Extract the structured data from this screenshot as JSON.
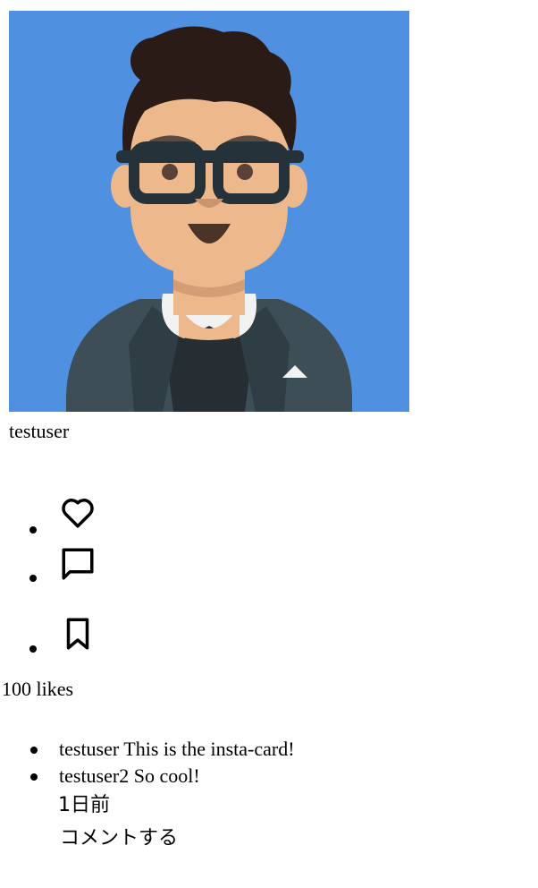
{
  "post": {
    "username": "testuser",
    "likes": "100 likes",
    "time": "1日前",
    "comment_action": "コメントする"
  },
  "actions": [
    {
      "icon": "heart-icon"
    },
    {
      "icon": "comment-icon"
    },
    {
      "icon": "bookmark-icon"
    }
  ],
  "comments": [
    {
      "text": "testuser This is the insta-card!"
    },
    {
      "text": "testuser2 So cool!"
    }
  ],
  "colors": {
    "avatar_bg": "#4f91e0",
    "hair": "#2a1b17",
    "skin": "#edb88b",
    "glasses": "#253239",
    "jacket": "#3e4e57",
    "shirt": "#262e33",
    "collar": "#f2f2f2"
  }
}
